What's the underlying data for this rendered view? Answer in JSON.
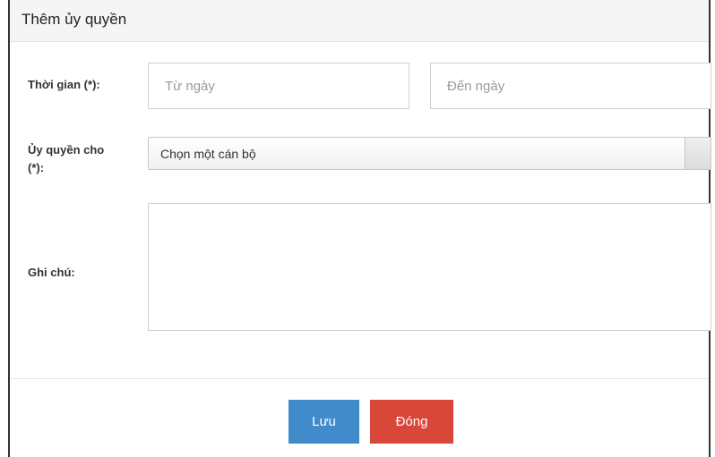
{
  "dialog": {
    "title": "Thêm ủy quyền"
  },
  "form": {
    "time_label": "Thời gian (*):",
    "from_date": {
      "placeholder": "Từ ngày",
      "value": ""
    },
    "to_date": {
      "placeholder": "Đến ngày",
      "value": ""
    },
    "delegate_label_line1": "Ủy quyền cho",
    "delegate_label_line2": "(*):",
    "delegate_select": {
      "selected": "Chọn một cán bộ"
    },
    "note_label": "Ghi chú:",
    "note": {
      "value": ""
    }
  },
  "footer": {
    "save_label": "Lưu",
    "close_label": "Đóng"
  },
  "colors": {
    "save_button": "#428bca",
    "close_button": "#d9473a",
    "header_bg": "#f5f5f5"
  }
}
